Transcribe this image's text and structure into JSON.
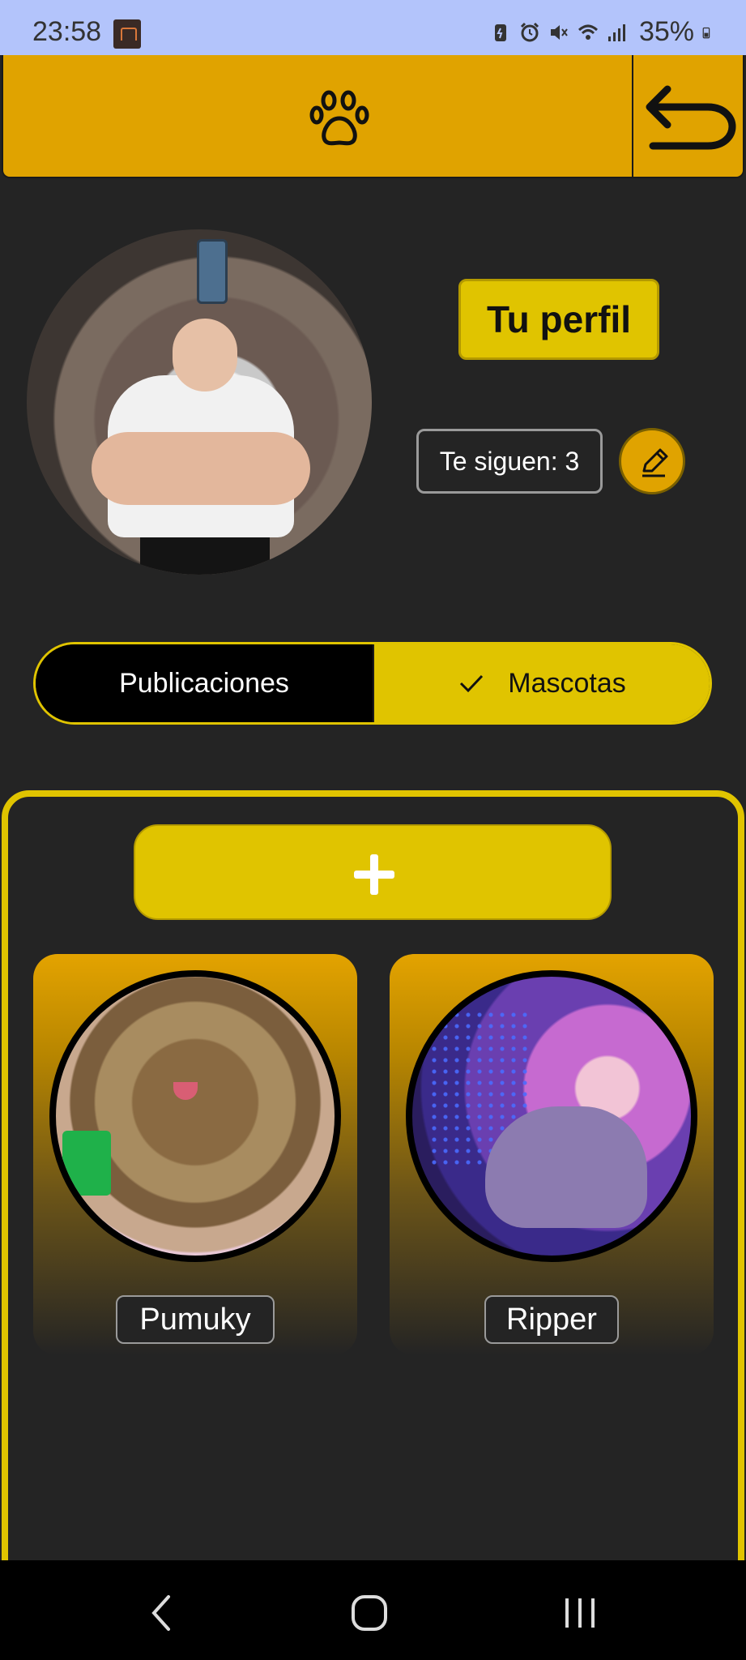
{
  "status_bar": {
    "time": "23:58",
    "battery_percent": "35%",
    "icons": [
      "app-notification-icon",
      "battery-saver-icon",
      "alarm-icon",
      "mute-icon",
      "wifi-icon",
      "signal-icon",
      "battery-icon"
    ]
  },
  "header": {
    "logo_icon": "paw-icon",
    "back_icon": "undo-arrow-icon"
  },
  "profile": {
    "title": "Tu perfil",
    "followers": "Te siguen: 3",
    "edit_icon": "pencil-icon"
  },
  "tabs": {
    "items": [
      {
        "label": "Publicaciones",
        "selected": false
      },
      {
        "label": "Mascotas",
        "selected": true
      }
    ]
  },
  "pets": {
    "add_icon": "plus-icon",
    "items": [
      {
        "name": "Pumuky"
      },
      {
        "name": "Ripper"
      }
    ]
  },
  "colors": {
    "background": "#242424",
    "accent_yellow": "#e0c400",
    "accent_orange": "#e0a300",
    "status_bar": "#b3c4fb"
  }
}
